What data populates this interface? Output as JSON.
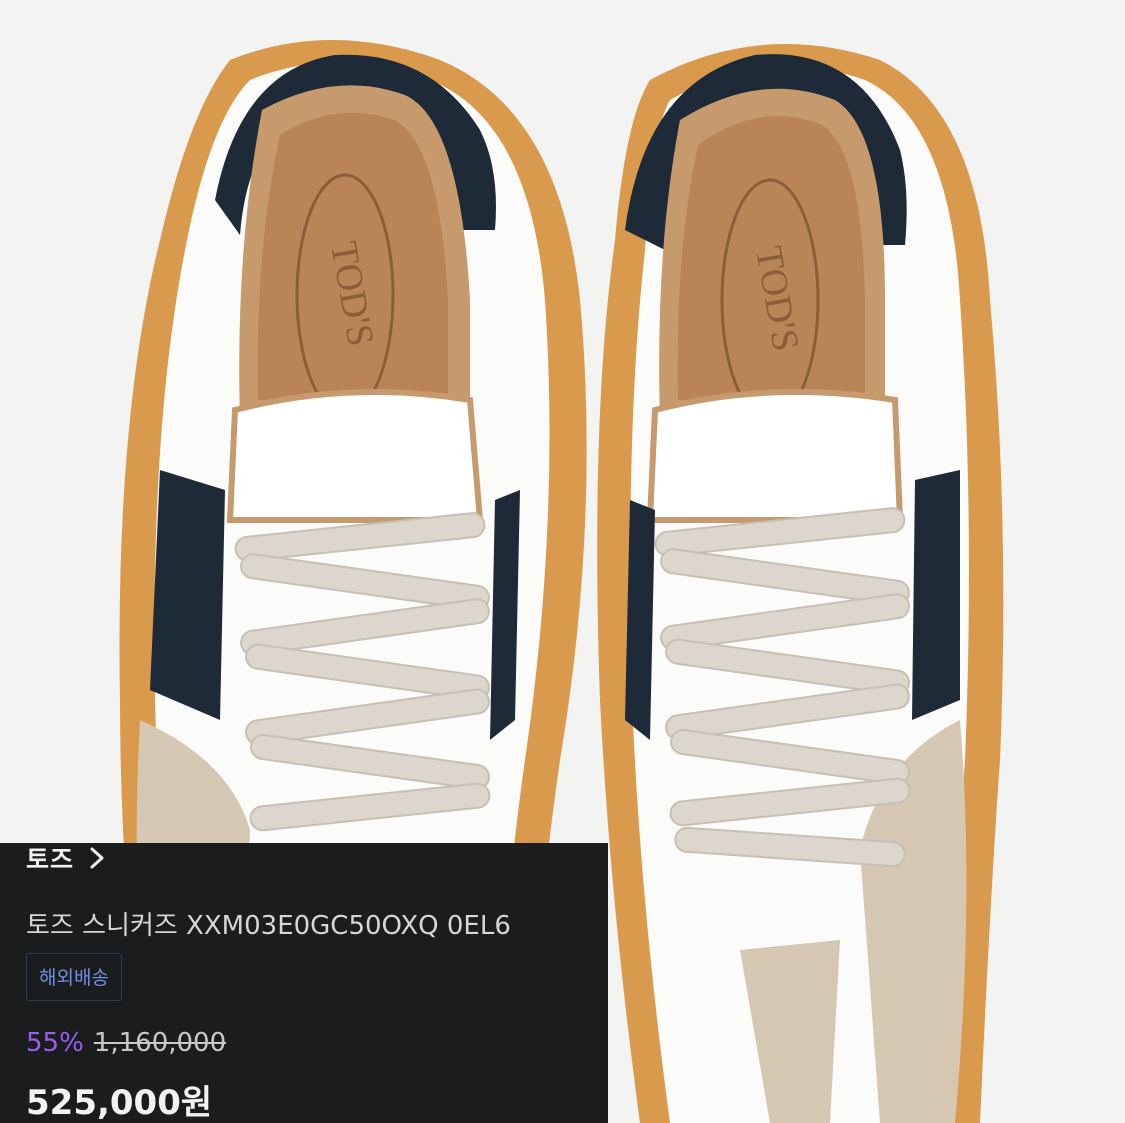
{
  "product": {
    "brand": "토즈",
    "title": "토즈 스니커즈 XXM03E0GC50OXQ 0EL6",
    "shipping_badge": "해외배송",
    "discount_rate": "55%",
    "original_price": "1,160,000",
    "sale_price": "525,000원",
    "image_logo_text": "TOD'S"
  },
  "icons": {
    "brand_link": "chevron-right-icon"
  },
  "colors": {
    "panel_bg": "#1b1c1e",
    "discount": "#9b5cf0",
    "badge_text": "#6f8fe6",
    "sole": "#d99a4e",
    "navy": "#1e2a38",
    "suede": "#d6c7b2"
  }
}
